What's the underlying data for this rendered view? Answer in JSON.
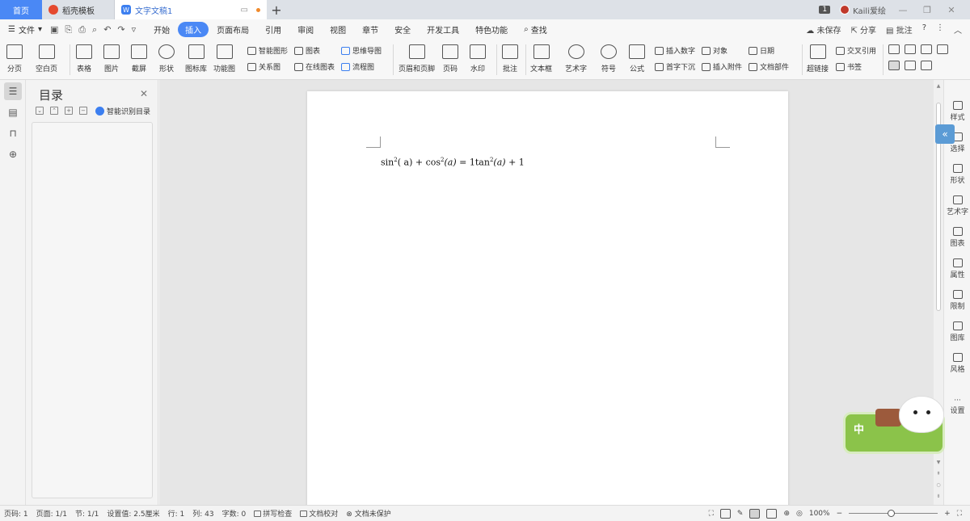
{
  "tabs": {
    "home": "首页",
    "template": "稻壳模板",
    "doc": "文字文稿1"
  },
  "titlebar": {
    "badge": "1",
    "user": "Kaili爱绘"
  },
  "menu": {
    "file": "文件",
    "items": [
      "开始",
      "插入",
      "页面布局",
      "引用",
      "审阅",
      "视图",
      "章节",
      "安全",
      "开发工具",
      "特色功能"
    ],
    "active": "插入",
    "search": "查找",
    "right": [
      "未保存",
      "分享",
      "批注"
    ]
  },
  "ribbon": {
    "page_break": "分页",
    "blank_page": "空白页",
    "table": "表格",
    "picture": "图片",
    "screenshot": "截屏",
    "shape": "形状",
    "icon_lib": "图标库",
    "func_chart": "功能图",
    "smart_shape": "智能图形",
    "chart": "图表",
    "mind_map": "思维导图",
    "relation": "关系图",
    "online_chart": "在线图表",
    "flowchart": "流程图",
    "header_footer": "页眉和页脚",
    "page_num": "页码",
    "watermark": "水印",
    "comment": "批注",
    "textbox": "文本框",
    "wordart": "艺术字",
    "symbol": "符号",
    "formula": "公式",
    "insert_number": "插入数字",
    "object": "对象",
    "date": "日期",
    "drop_cap": "首字下沉",
    "attachment": "插入附件",
    "doc_part": "文档部件",
    "hyperlink": "超链接",
    "cross_ref": "交叉引用",
    "bookmark": "书签"
  },
  "toc": {
    "title": "目录",
    "smart": "智能识别目录"
  },
  "document": {
    "formula": {
      "sin": "sin",
      "sin_exp": "2",
      "sin_arg": "( a)",
      "plus1": "+",
      "cos": "cos",
      "cos_exp": "2",
      "cos_arg": "(a)",
      "eq": "=",
      "one": "1",
      "tan": "tan",
      "tan_exp": "2",
      "tan_arg": "(a)",
      "plus2": "+",
      "last": "1"
    }
  },
  "sidepanel": [
    "样式",
    "选择",
    "形状",
    "艺术字",
    "图表",
    "属性",
    "限制",
    "图库",
    "风格",
    "设置"
  ],
  "ime": {
    "mode": "中"
  },
  "status": {
    "page_num": "页码: 1",
    "pages": "页面: 1/1",
    "section": "节: 1/1",
    "setting": "设置值: 2.5厘米",
    "row": "行: 1",
    "col": "列: 43",
    "words": "字数: 0",
    "spell": "拼写检查",
    "proof": "文档校对",
    "protect": "文档未保护",
    "zoom": "100%"
  }
}
